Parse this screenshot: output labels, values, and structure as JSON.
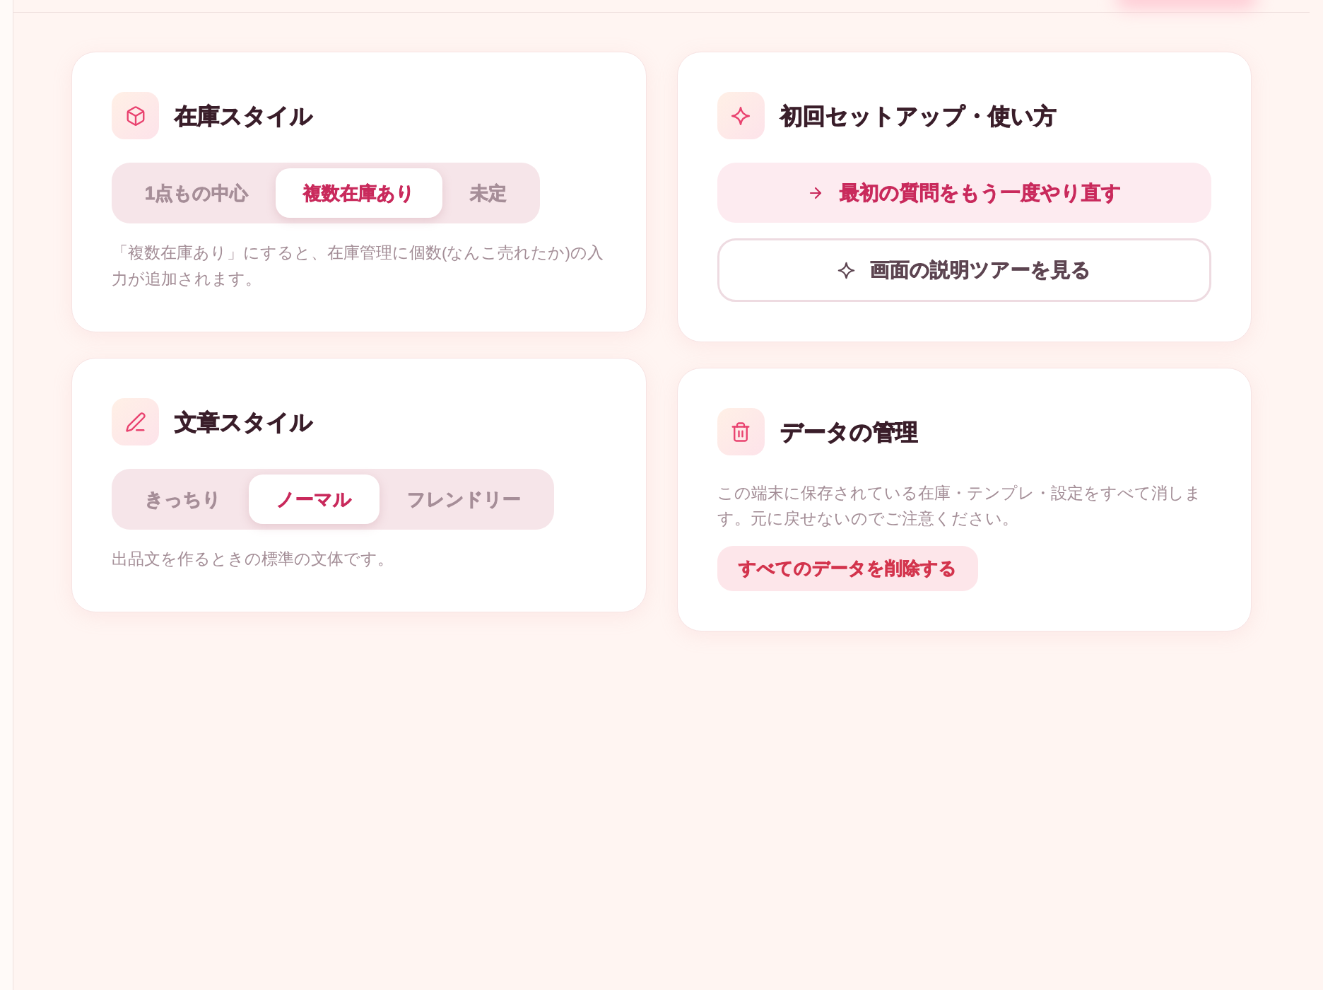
{
  "columns": [
    {
      "cards": [
        {
          "kind": "segmented",
          "title": "在庫スタイル",
          "options": [
            {
              "label": "1点もの中心",
              "selected": false
            },
            {
              "label": "複数在庫あり",
              "selected": true
            },
            {
              "label": "未定",
              "selected": false
            }
          ],
          "description": "「複数在庫あり」にすると、在庫管理に個数(なんこ売れたか)の入力が追加されます。"
        },
        {
          "kind": "segmented",
          "title": "文章スタイル",
          "options": [
            {
              "label": "きっちり",
              "selected": false
            },
            {
              "label": "ノーマル",
              "selected": true
            },
            {
              "label": "フレンドリー",
              "selected": false
            }
          ],
          "description": "出品文を作るときの標準の文体です。"
        }
      ]
    },
    {
      "cards": [
        {
          "kind": "actions",
          "title": "初回セットアップ・使い方",
          "buttons": [
            {
              "kind": "filled",
              "label": "最初の質問をもう一度やり直す"
            },
            {
              "kind": "outlined",
              "label": "画面の説明ツアーを見る"
            }
          ]
        },
        {
          "kind": "danger",
          "title": "データの管理",
          "description": "この端末に保存されている在庫・テンプレ・設定をすべて消します。元に戻せないのでご注意ください。",
          "button": {
            "label": "すべてのデータを削除する"
          }
        }
      ]
    }
  ]
}
